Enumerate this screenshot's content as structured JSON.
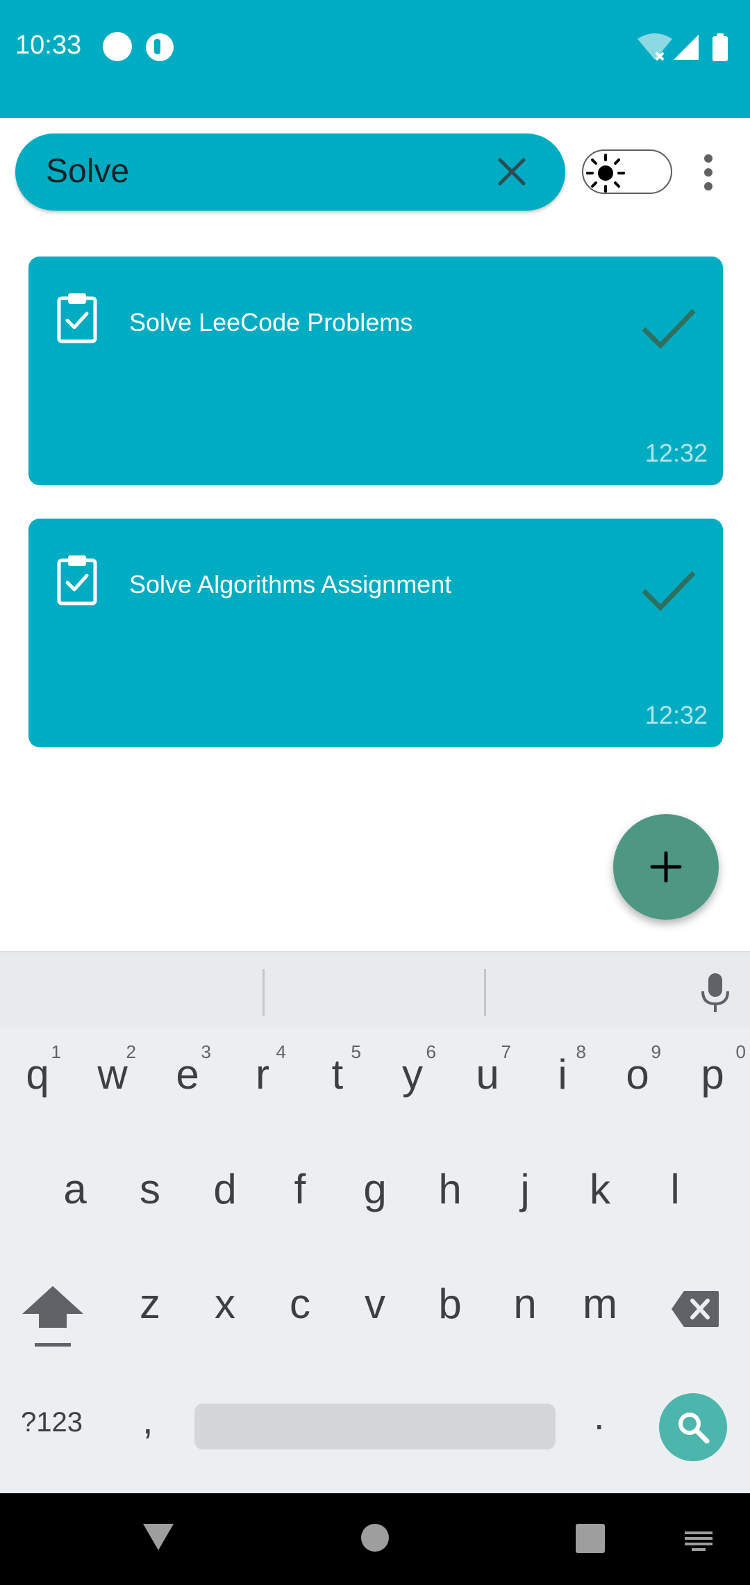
{
  "status_bar": {
    "time": "10:33",
    "icons": [
      "notification-dot-icon",
      "app-notification-icon",
      "wifi-icon",
      "signal-icon",
      "battery-icon"
    ]
  },
  "search": {
    "query": "Solve",
    "clear_icon": "close-icon"
  },
  "toolbar": {
    "theme_toggle_icon": "sun-icon",
    "more_icon": "more-vert-icon"
  },
  "tasks": [
    {
      "title": "Solve LeeCode Problems",
      "time": "12:32",
      "icon": "clipboard-check-icon",
      "status_icon": "check-icon"
    },
    {
      "title": "Solve Algorithms Assignment",
      "time": "12:32",
      "icon": "clipboard-check-icon",
      "status_icon": "check-icon"
    }
  ],
  "fab": {
    "icon": "add-icon"
  },
  "keyboard": {
    "row1": [
      {
        "key": "q",
        "num": "1"
      },
      {
        "key": "w",
        "num": "2"
      },
      {
        "key": "e",
        "num": "3"
      },
      {
        "key": "r",
        "num": "4"
      },
      {
        "key": "t",
        "num": "5"
      },
      {
        "key": "y",
        "num": "6"
      },
      {
        "key": "u",
        "num": "7"
      },
      {
        "key": "i",
        "num": "8"
      },
      {
        "key": "o",
        "num": "9"
      },
      {
        "key": "p",
        "num": "0"
      }
    ],
    "row2": [
      "a",
      "s",
      "d",
      "f",
      "g",
      "h",
      "j",
      "k",
      "l"
    ],
    "row3": [
      "z",
      "x",
      "c",
      "v",
      "b",
      "n",
      "m"
    ],
    "symbols_label": "?123",
    "comma": ",",
    "period": ".",
    "colors": {
      "background": "#eceff1",
      "key_text": "#3c4043",
      "action": "#4db6ac"
    }
  },
  "colors": {
    "primary": "#00acc1",
    "fab": "#4e9883",
    "check": "#2f6f5f",
    "time_text": "#b3e5ec"
  }
}
